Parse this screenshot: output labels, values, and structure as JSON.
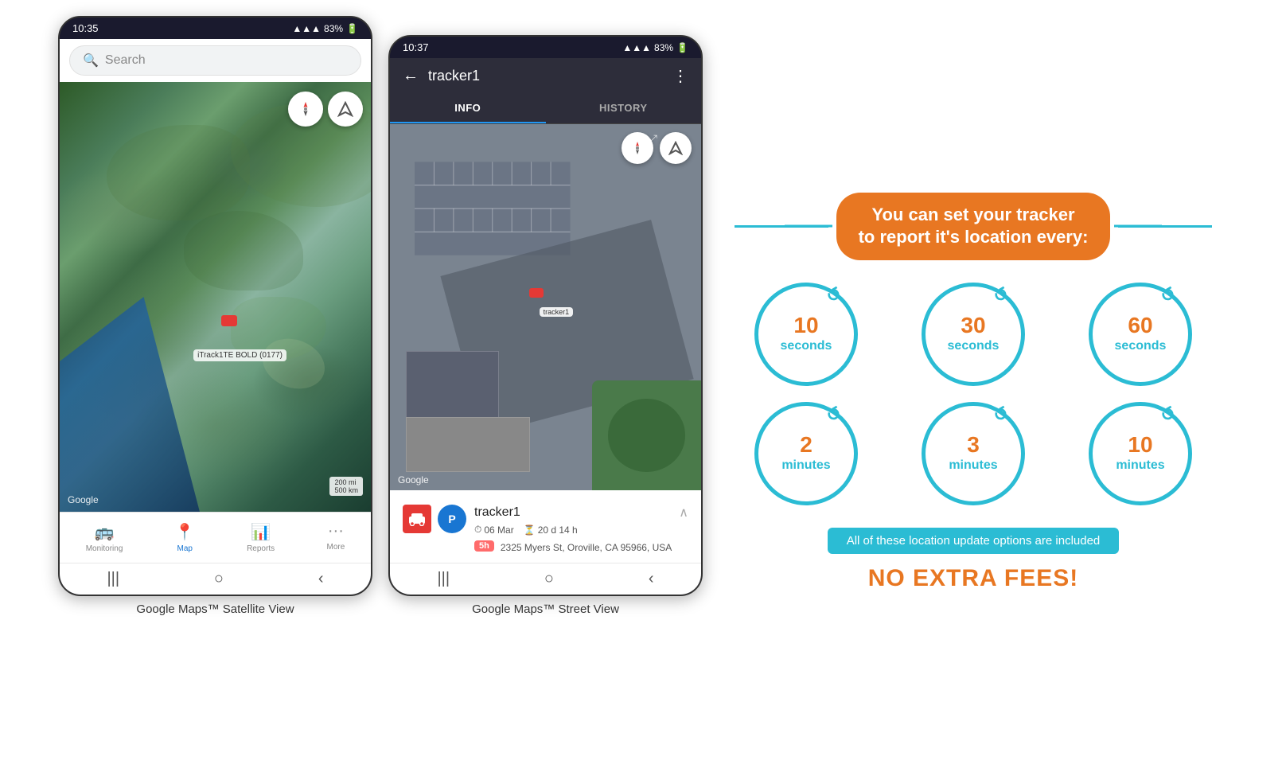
{
  "phone1": {
    "status_bar": {
      "time": "10:35",
      "signal": "▲▲▲",
      "battery": "83%"
    },
    "search": {
      "placeholder": "Search"
    },
    "map": {
      "tracker_label": "iTrack1TE BOLD (0177)",
      "google_label": "Google",
      "scale_200mi": "200 mi",
      "scale_500km": "500 km"
    },
    "nav": {
      "items": [
        {
          "id": "monitoring",
          "label": "Monitoring",
          "icon": "🚌",
          "active": false
        },
        {
          "id": "map",
          "label": "Map",
          "icon": "📍",
          "active": true
        },
        {
          "id": "reports",
          "label": "Reports",
          "icon": "📊",
          "active": false
        },
        {
          "id": "more",
          "label": "More",
          "icon": "···",
          "active": false
        }
      ]
    },
    "gesture_bar": [
      "|||",
      "○",
      "<"
    ]
  },
  "phone2": {
    "status_bar": {
      "time": "10:37",
      "signal": "▲▲▲",
      "battery": "83%"
    },
    "header": {
      "title": "tracker1",
      "back_icon": "←",
      "more_icon": "⋮"
    },
    "tabs": [
      {
        "id": "info",
        "label": "INFO",
        "active": true
      },
      {
        "id": "history",
        "label": "HISTORY",
        "active": false
      }
    ],
    "map": {
      "tracker_label": "tracker1",
      "google_label": "Google"
    },
    "tracker_info": {
      "name": "tracker1",
      "avatar_letter": "P",
      "date": "06 Mar",
      "duration": "20 d 14 h",
      "address": "2325 Myers St, Oroville, CA 95966, USA",
      "badge": "5h"
    },
    "gesture_bar": [
      "|||",
      "○",
      "<"
    ]
  },
  "infographic": {
    "banner_text": "You can set your tracker\nto report it's location every:",
    "circles": [
      {
        "number": "10",
        "unit": "seconds"
      },
      {
        "number": "30",
        "unit": "seconds"
      },
      {
        "number": "60",
        "unit": "seconds"
      },
      {
        "number": "2",
        "unit": "minutes"
      },
      {
        "number": "3",
        "unit": "minutes"
      },
      {
        "number": "10",
        "unit": "minutes"
      }
    ],
    "no_fees_banner": "All of these location update options are included",
    "no_fees_text": "NO EXTRA FEES!",
    "accent_color": "#E87722",
    "teal_color": "#2BBCD4"
  },
  "captions": {
    "left": "Google Maps™ Satellite View",
    "right": "Google Maps™ Street View"
  }
}
